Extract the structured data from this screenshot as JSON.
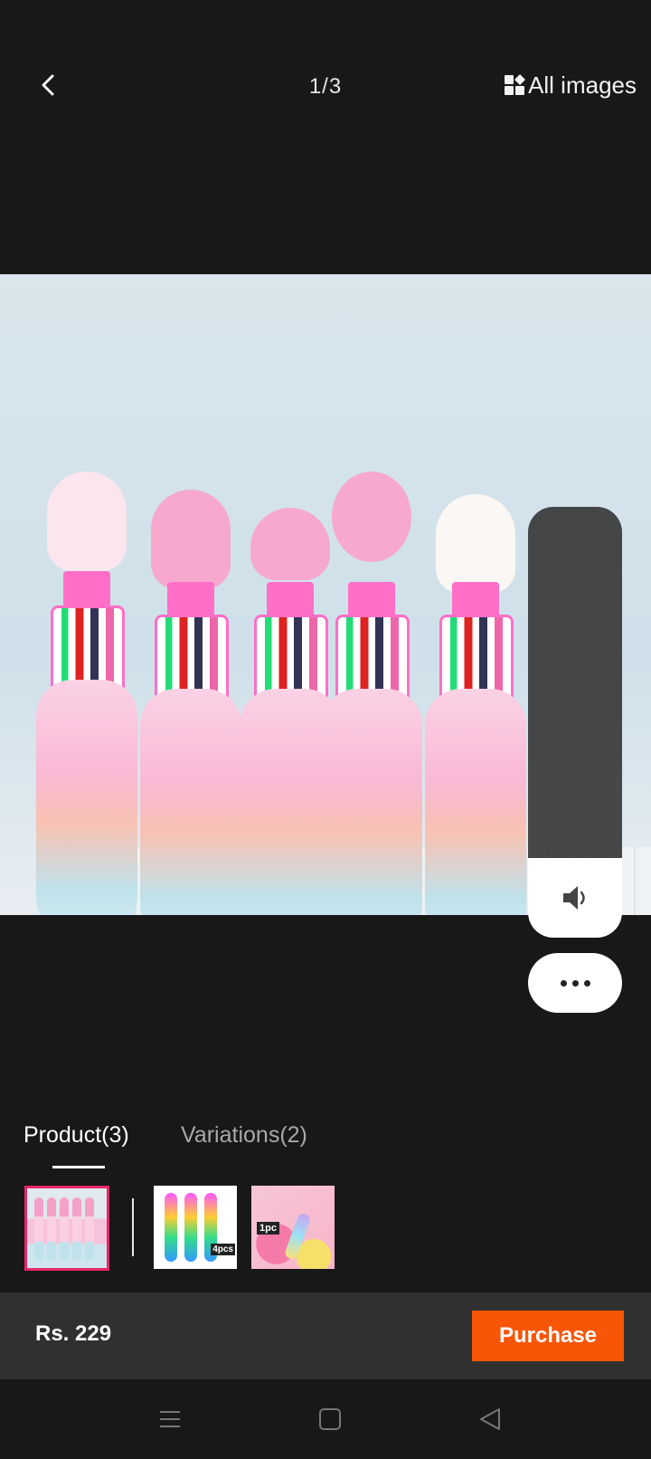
{
  "header": {
    "image_counter": "1/3",
    "all_images_label": "All images"
  },
  "tabs": [
    {
      "label": "Product(3)",
      "active": true
    },
    {
      "label": "Variations(2)",
      "active": false
    }
  ],
  "thumbnails": [
    {
      "selected": true
    },
    {
      "badge": "4pcs",
      "selected": false
    },
    {
      "badge": "1pc",
      "selected": false
    }
  ],
  "bottom_bar": {
    "price": "Rs. 229",
    "purchase_label": "Purchase"
  },
  "colors": {
    "background": "#181818",
    "accent": "#f85606",
    "selected_thumb_border": "#e8266b",
    "bottom_bar": "#303030"
  },
  "icons": {
    "back": "chevron-left-icon",
    "all_images": "grid-icon",
    "volume": "speaker-icon",
    "more": "more-dots-icon",
    "nav_menu": "menu-icon",
    "nav_home": "home-square-icon",
    "nav_back": "back-triangle-icon"
  }
}
